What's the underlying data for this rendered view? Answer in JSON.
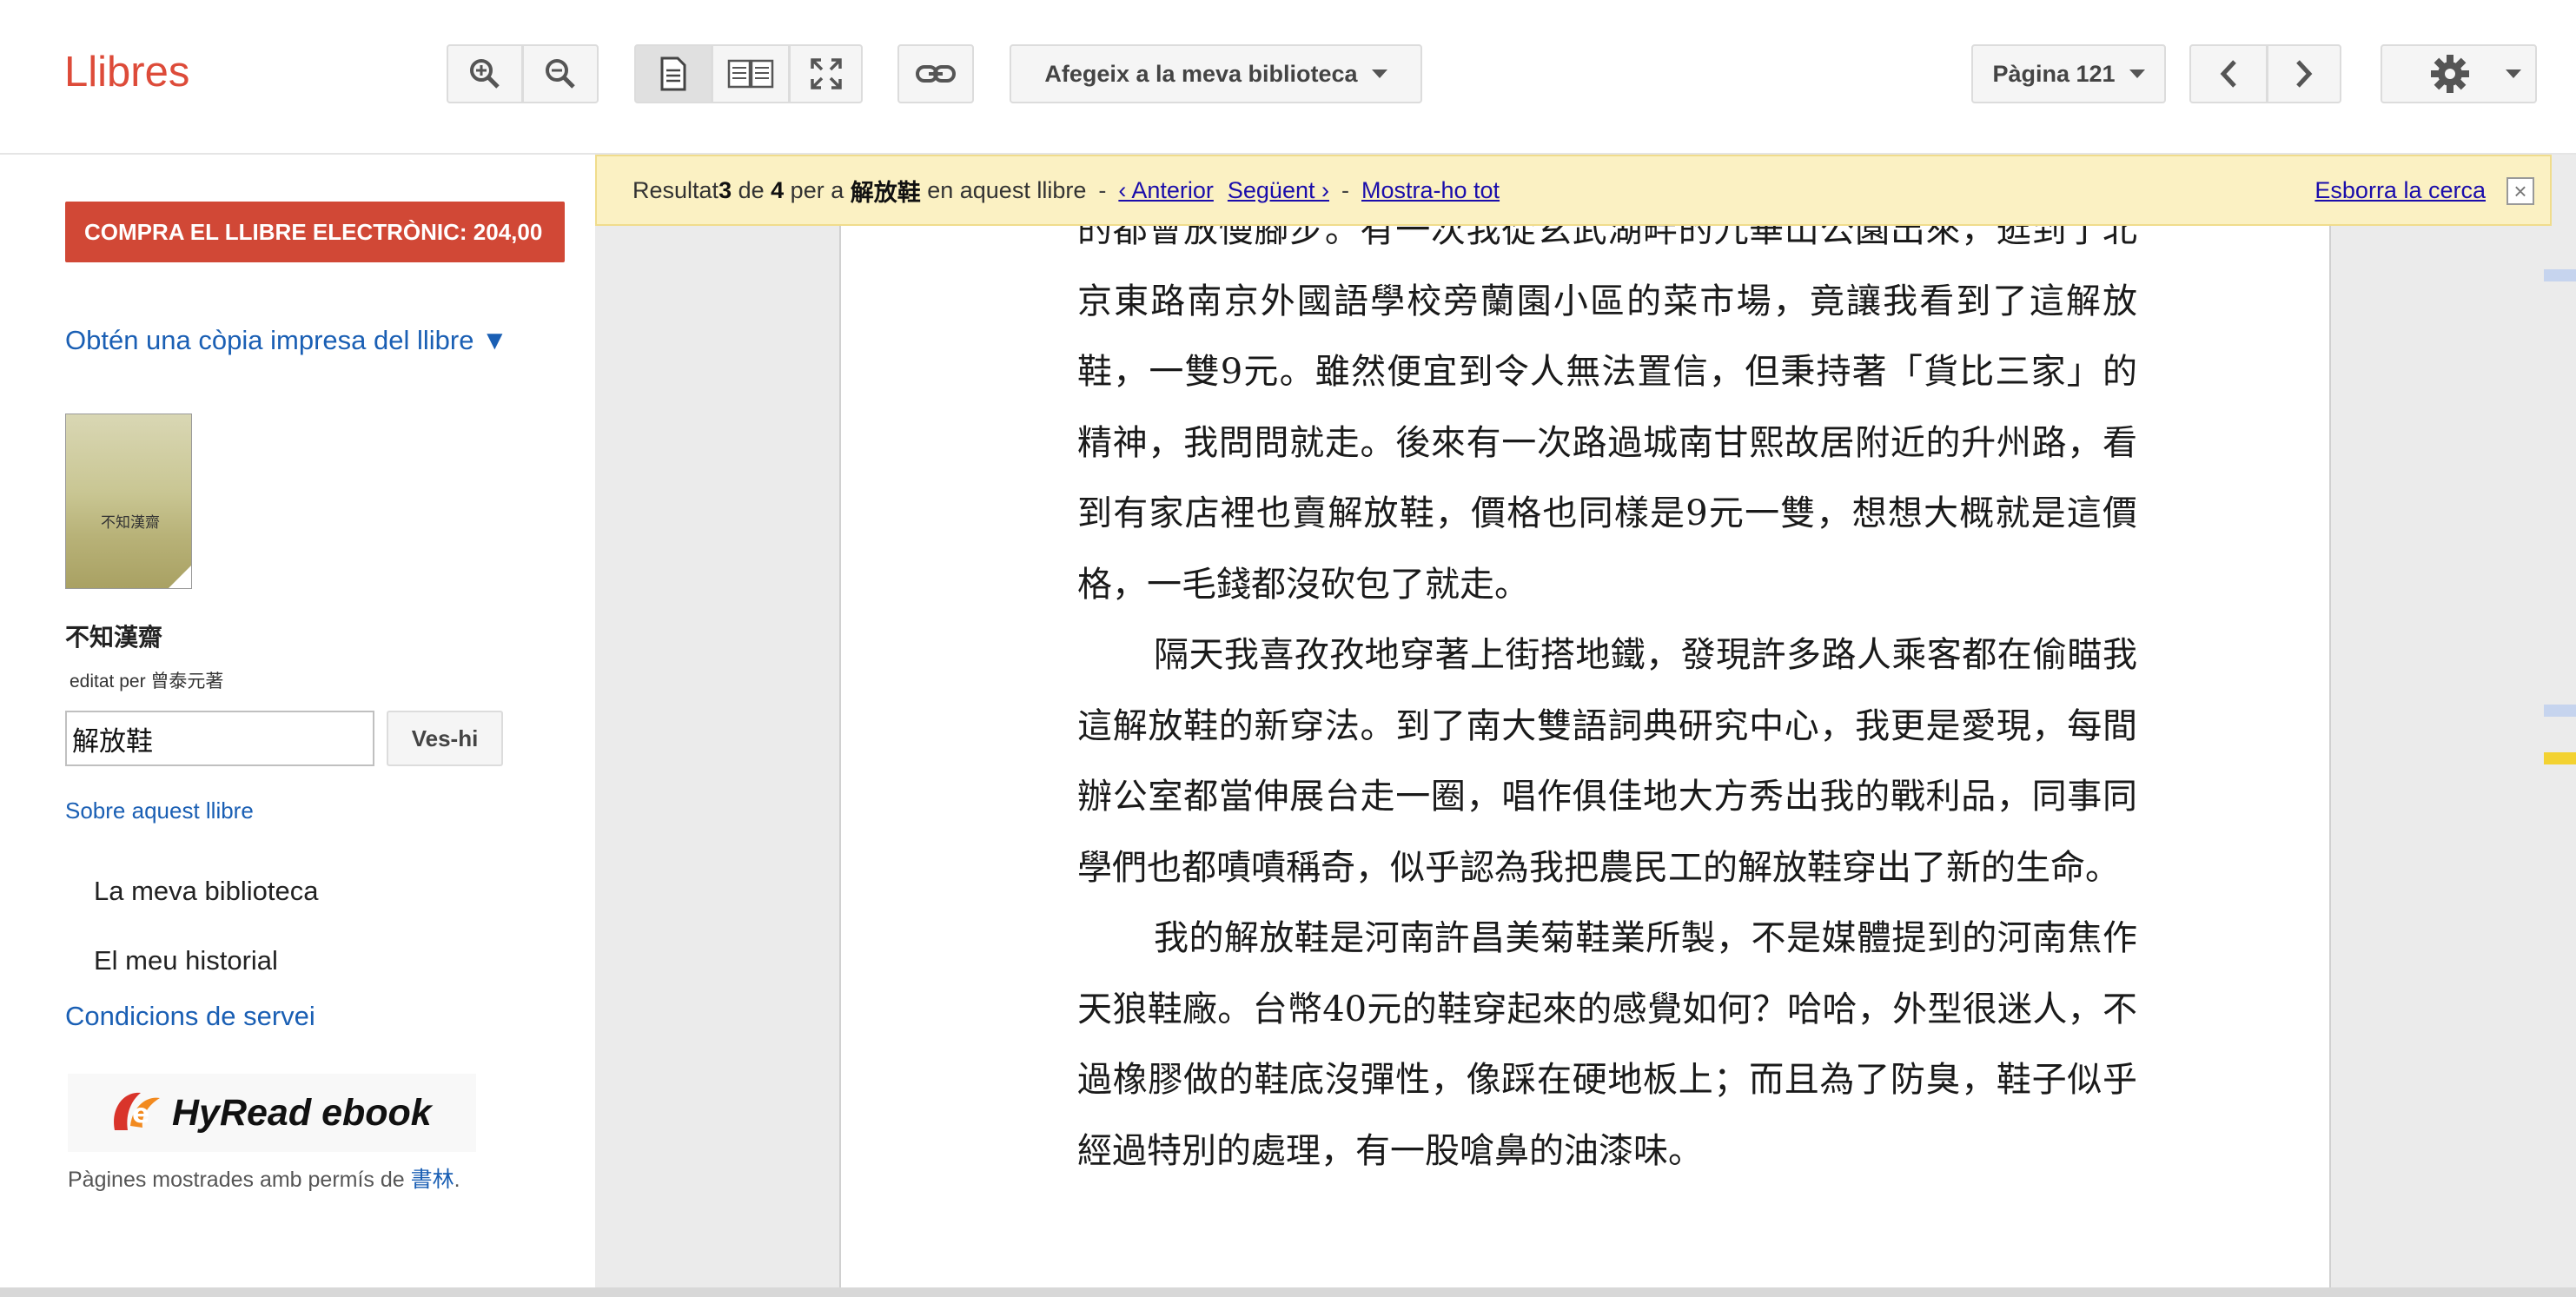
{
  "app": {
    "logo": "Llibres"
  },
  "toolbar": {
    "zoom_in_icon": "zoom-in-icon",
    "zoom_out_icon": "zoom-out-icon",
    "single_page_icon": "single-page-icon",
    "two_page_icon": "two-page-icon",
    "fullscreen_icon": "fullscreen-icon",
    "link_icon": "link-icon",
    "add_library_label": "Afegeix a la meva biblioteca",
    "page_label": "Pàgina 121",
    "prev_icon": "chevron-left-icon",
    "next_icon": "chevron-right-icon",
    "settings_icon": "gear-icon"
  },
  "sidebar": {
    "buy_label": "COMPRA EL LLIBRE ELECTRÒNIC: 204,00",
    "print_copy_label": "Obtén una còpia impresa del llibre ▼",
    "cover_text": "不知漢齋",
    "book_title": "不知漢齋",
    "editor": "editat per 曾泰元著",
    "search_value": "解放鞋",
    "search_button": "Ves-hi",
    "about_link": "Sobre aquest llibre",
    "my_library": "La meva biblioteca",
    "my_history": "El meu historial",
    "terms": "Condicions de servei",
    "publisher_logo_text": "HyRead ebook",
    "permission_text": "Pàgines mostrades amb permís de ",
    "permission_link": "書林",
    "permission_end": "."
  },
  "searchbar": {
    "result_prefix": "Resultat ",
    "result_index": "3",
    "of_word": " de ",
    "result_total": "4",
    "for_word": " per a ",
    "query": "解放鞋",
    "in_book": " en aquest llibre",
    "prev_link": "‹ Anterior",
    "next_link": "Següent ›",
    "show_all_link": "Mostra-ho tot",
    "clear_link": "Esborra la cerca"
  },
  "page": {
    "paragraphs": [
      {
        "indent": false,
        "text": "的都會放慢腳步。有一次我從玄武湖畔的九華山公園出來，逛到了北京東路南京外國語學校旁蘭園小區的菜市場，竟讓我看到了這解放鞋，一雙9元。雖然便宜到令人無法置信，但秉持著「貨比三家」的精神，我問問就走。後來有一次路過城南甘熙故居附近的升州路，看到有家店裡也賣解放鞋，價格也同樣是9元一雙，想想大概就是這價格，一毛錢都沒砍包了就走。"
      },
      {
        "indent": true,
        "text": "隔天我喜孜孜地穿著上街搭地鐵，發現許多路人乘客都在偷瞄我這解放鞋的新穿法。到了南大雙語詞典研究中心，我更是愛現，每間辦公室都當伸展台走一圈，唱作俱佳地大方秀出我的戰利品，同事同學們也都嘖嘖稱奇，似乎認為我把農民工的解放鞋穿出了新的生命。"
      },
      {
        "indent": true,
        "text": "我的解放鞋是河南許昌美菊鞋業所製，不是媒體提到的河南焦作天狼鞋廠。台幣40元的鞋穿起來的感覺如何？哈哈，外型很迷人，不過橡膠做的鞋底沒彈性，像踩在硬地板上；而且為了防臭，鞋子似乎經過特別的處理，有一股嗆鼻的油漆味。"
      }
    ]
  },
  "colors": {
    "brand": "#dd4b39",
    "buy_button": "#d14836",
    "link": "#1a5fb4",
    "searchbar_bg": "#fbf1c3",
    "marker_blue": "#c6d4ee",
    "marker_yellow": "#f3d231"
  }
}
